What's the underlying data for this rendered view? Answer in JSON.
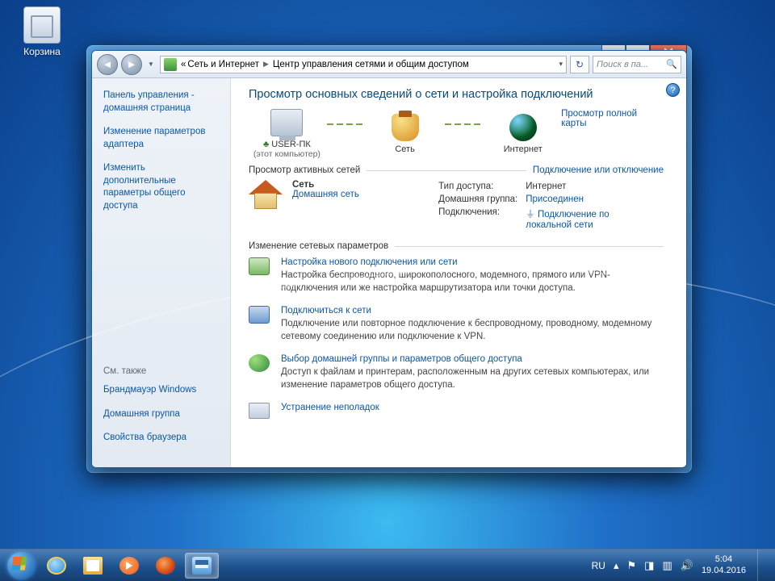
{
  "desktop": {
    "recycle_bin": "Корзина"
  },
  "window": {
    "controls": {
      "min": "_",
      "max": "",
      "close": ""
    },
    "breadcrumb": {
      "root_prefix": "«",
      "root": "Сеть и Интернет",
      "current": "Центр управления сетями и общим доступом"
    },
    "search_placeholder": "Поиск в па...",
    "sidebar": {
      "links": [
        "Панель управления - домашняя страница",
        "Изменение параметров адаптера",
        "Изменить дополнительные параметры общего доступа"
      ],
      "see_also_head": "См. также",
      "see_also": [
        "Брандмауэр Windows",
        "Домашняя группа",
        "Свойства браузера"
      ]
    },
    "main": {
      "title": "Просмотр основных сведений о сети и настройка подключений",
      "full_map": "Просмотр полной карты",
      "map": {
        "pc": "USER-ПК",
        "pc_sub": "(этот компьютер)",
        "net": "Сеть",
        "internet": "Интернет"
      },
      "active_head": "Просмотр активных сетей",
      "connect_disconnect": "Подключение или отключение",
      "active": {
        "name": "Сеть",
        "type_link": "Домашняя сеть",
        "k_access": "Тип доступа:",
        "v_access": "Интернет",
        "k_hg": "Домашняя группа:",
        "v_hg": "Присоединен",
        "k_conn": "Подключения:",
        "v_conn": "Подключение по локальной сети"
      },
      "change_head": "Изменение сетевых параметров",
      "tasks": [
        {
          "title": "Настройка нового подключения или сети",
          "desc": "Настройка беспроводного, широкополосного, модемного, прямого или VPN-подключения или же настройка маршрутизатора или точки доступа."
        },
        {
          "title": "Подключиться к сети",
          "desc": "Подключение или повторное подключение к беспроводному, проводному, модемному сетевому соединению или подключение к VPN."
        },
        {
          "title": "Выбор домашней группы и параметров общего доступа",
          "desc": "Доступ к файлам и принтерам, расположенным на других сетевых компьютерах, или изменение параметров общего доступа."
        },
        {
          "title": "Устранение неполадок",
          "desc": ""
        }
      ]
    }
  },
  "taskbar": {
    "lang": "RU",
    "time": "5:04",
    "date": "19.04.2016"
  }
}
